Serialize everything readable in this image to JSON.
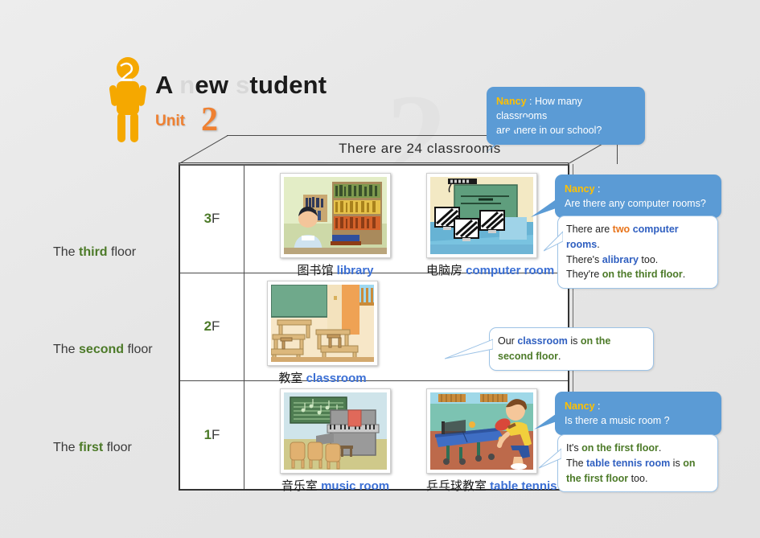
{
  "slide": {
    "title_line": "A new student",
    "title_part_visible": "A ",
    "title_part_faded1": "n",
    "title_part_mid": "ew ",
    "title_part_faded2": "s",
    "title_part_end": "tudent",
    "unit_label": "Unit",
    "unit_number": "2",
    "watermark": "2",
    "person_icon": "student-figure-icon"
  },
  "building": {
    "roof_caption": "There are 24 classrooms",
    "floors": [
      {
        "side_label_prefix": "The ",
        "side_label_ordinal": "third",
        "side_label_suffix": " floor",
        "tag_number": "3",
        "tag_suffix": "F",
        "rooms": [
          {
            "cn": "图书馆 ",
            "en": "library",
            "icon": "library-illustration"
          },
          {
            "cn": "电脑房 ",
            "en": "computer room",
            "icon": "computer-room-illustration"
          }
        ]
      },
      {
        "side_label_prefix": "The ",
        "side_label_ordinal": "second",
        "side_label_suffix": " floor",
        "tag_number": "2",
        "tag_suffix": "F",
        "rooms": [
          {
            "cn": "教室 ",
            "en": "classroom",
            "icon": "classroom-illustration"
          }
        ]
      },
      {
        "side_label_prefix": "The ",
        "side_label_ordinal": "first",
        "side_label_suffix": " floor",
        "tag_number": "1",
        "tag_suffix": "F",
        "rooms": [
          {
            "cn": "音乐室 ",
            "en": "music room",
            "icon": "music-room-illustration"
          },
          {
            "cn": "乒乓球教室 ",
            "en": "table tennis room",
            "icon": "table-tennis-room-illustration"
          }
        ]
      }
    ]
  },
  "bubbles": {
    "q1": {
      "speaker": "Nancy",
      "colon": " : ",
      "line1": "How many classrooms",
      "line2": "are there in our school?"
    },
    "q2": {
      "speaker": "Nancy",
      "colon": " :",
      "line1": "Are there any computer rooms?"
    },
    "a2": {
      "l1_a": "There are ",
      "l1_two": "two",
      "l1_b": " ",
      "l1_rooms": "computer rooms",
      "l1_c": ".",
      "l2_a": "There's ",
      "l2_lib": "alibrary",
      "l2_b": " too.",
      "l3_a": "They're ",
      "l3_floor": "on the third floor",
      "l3_b": "."
    },
    "a3": {
      "l1_a": "Our ",
      "l1_class": "classroom",
      "l1_b": " is ",
      "l1_floor": "on the second floor",
      "l1_c": "."
    },
    "q4": {
      "speaker": "Nancy",
      "colon": " :",
      "line1": "Is there a music room ?"
    },
    "a4": {
      "l1_a": "It's ",
      "l1_floor": "on the first floor",
      "l1_b": ".",
      "l2_a": "The ",
      "l2_room": "table tennis room",
      "l2_b": " is ",
      "l2_floor": "on the first floor",
      "l2_c": " too."
    }
  },
  "colors": {
    "bubble_blue": "#5b9bd5",
    "speaker_gold": "#ffc000",
    "green": "#4c7a28",
    "link_blue": "#3b6fd4",
    "orange": "#ef8031"
  }
}
